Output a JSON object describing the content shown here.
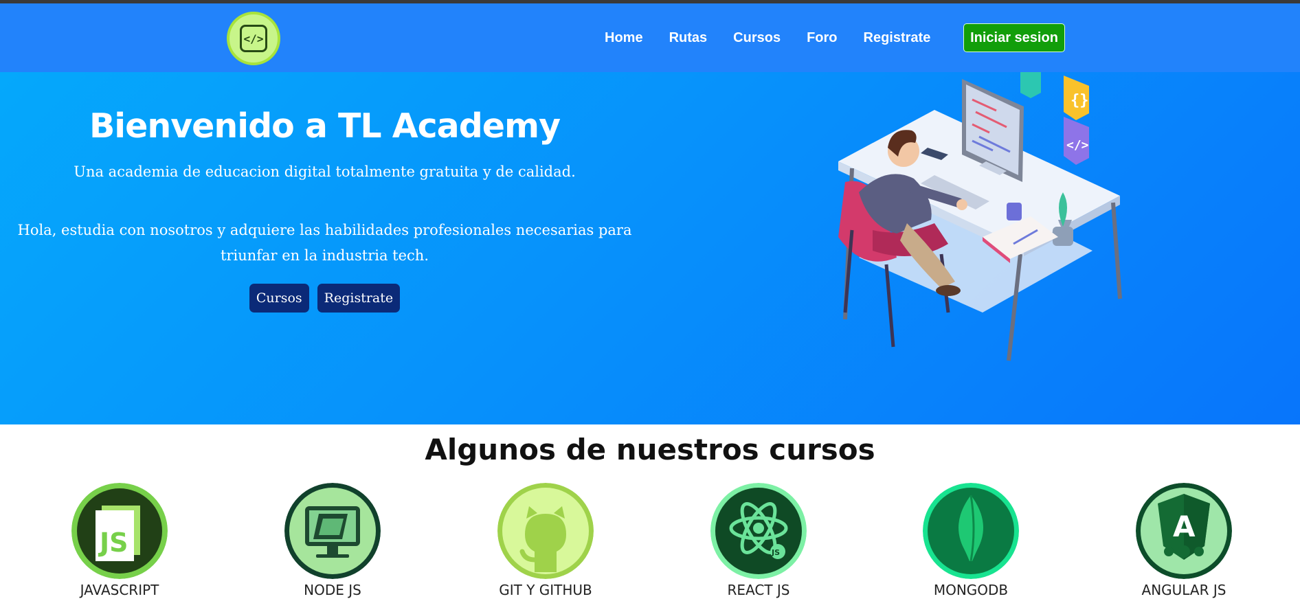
{
  "nav": {
    "logo_glyph": "</>",
    "links": [
      "Home",
      "Rutas",
      "Cursos",
      "Foro",
      "Registrate"
    ],
    "login_label": "Iniciar sesion"
  },
  "hero": {
    "title": "Bienvenido a TL Academy",
    "subtitle": "Una academia de educacion digital totalmente gratuita y de calidad.",
    "description": "Hola, estudia con nosotros y adquiere las habilidades profesionales necesarias para triunfar en la industria tech.",
    "btn_cursos": "Cursos",
    "btn_registrate": "Registrate"
  },
  "courses": {
    "title": "Algunos de nuestros cursos",
    "items": [
      {
        "label": "JAVASCRIPT",
        "icon": "javascript-icon"
      },
      {
        "label": "NODE JS",
        "icon": "nodejs-icon"
      },
      {
        "label": "GIT Y GITHUB",
        "icon": "github-icon"
      },
      {
        "label": "REACT JS",
        "icon": "react-icon"
      },
      {
        "label": "MONGODB",
        "icon": "mongodb-icon"
      },
      {
        "label": "ANGULAR JS",
        "icon": "angular-icon"
      }
    ]
  },
  "colors": {
    "navbar": "#2283fb",
    "login_button": "#129e0a",
    "hero_button": "#0b2a78"
  }
}
